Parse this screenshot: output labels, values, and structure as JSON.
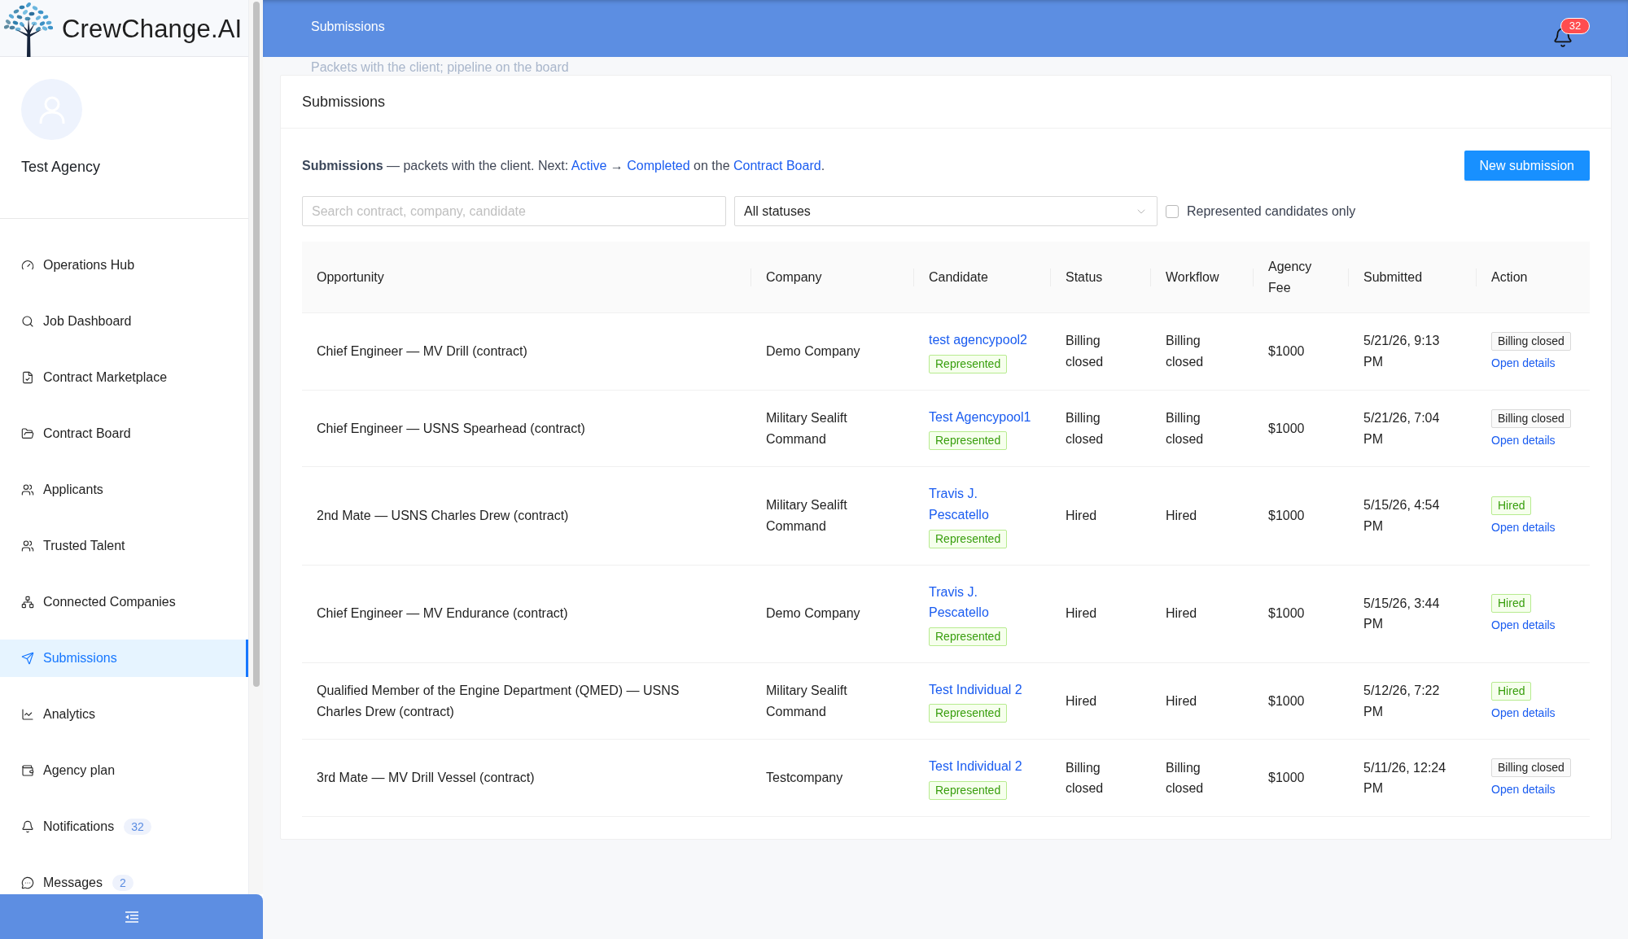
{
  "sidebar": {
    "brand": {
      "name": "CrewChange.AI"
    },
    "profile": {
      "name": "Test Agency"
    },
    "nav": [
      {
        "label": "Operations Hub",
        "selected": false
      },
      {
        "label": "Job Dashboard",
        "selected": false
      },
      {
        "label": "Contract Marketplace",
        "selected": false
      },
      {
        "label": "Contract Board",
        "selected": false
      },
      {
        "label": "Applicants",
        "selected": false
      },
      {
        "label": "Trusted Talent",
        "selected": false
      },
      {
        "label": "Connected Companies",
        "selected": false
      },
      {
        "label": "Submissions",
        "selected": true
      },
      {
        "label": "Analytics",
        "selected": false
      },
      {
        "label": "Agency plan",
        "selected": false
      },
      {
        "label": "Notifications",
        "selected": false,
        "badge": "32"
      },
      {
        "label": "Messages",
        "selected": false,
        "badge": "2"
      }
    ]
  },
  "header": {
    "title": "Submissions",
    "subtitle": "Packets with the client; pipeline on the board",
    "notification_count": "32"
  },
  "card": {
    "title": "Submissions",
    "intro": [
      {
        "kind": "text",
        "text": "**Submissions** — packets with the client. Next: "
      },
      {
        "kind": "link",
        "text": "Active"
      },
      {
        "kind": "text",
        "text": " → "
      },
      {
        "kind": "link",
        "text": "Completed"
      },
      {
        "kind": "text",
        "text": " on the "
      },
      {
        "kind": "link",
        "text": "Contract Board"
      },
      {
        "kind": "text",
        "text": "."
      }
    ],
    "new_button": "New submission"
  },
  "filters": {
    "search": {
      "placeholder": "Search contract, company, candidate"
    },
    "status": {
      "value": "All statuses"
    },
    "represented_only": {
      "label": "Represented candidates only",
      "checked": false
    }
  },
  "table": {
    "columns": [
      "Opportunity",
      "Company",
      "Candidate",
      "Status",
      "Workflow",
      "Agency Fee",
      "Submitted",
      "Action"
    ],
    "rows": [
      {
        "opportunity": "Chief Engineer — MV Drill (contract)",
        "company": "Demo Company",
        "candidate": {
          "name": "test agencypool2",
          "tag": "Represented"
        },
        "status": "Billing closed",
        "workflow": "Billing closed",
        "agency_fee": "$1000",
        "submitted": "5/21/26, 9:13 PM",
        "action": {
          "tag": "Billing closed",
          "kind": "neutral",
          "link": "Open details"
        }
      },
      {
        "opportunity": "Chief Engineer — USNS Spearhead (contract)",
        "company": "Military Sealift Command",
        "candidate": {
          "name": "Test Agencypool1",
          "tag": "Represented"
        },
        "status": "Billing closed",
        "workflow": "Billing closed",
        "agency_fee": "$1000",
        "submitted": "5/21/26, 7:04 PM",
        "action": {
          "tag": "Billing closed",
          "kind": "neutral",
          "link": "Open details"
        }
      },
      {
        "opportunity": "2nd Mate — USNS Charles Drew (contract)",
        "company": "Military Sealift Command",
        "candidate": {
          "name": "Travis J. Pescatello",
          "tag": "Represented"
        },
        "status": "Hired",
        "workflow": "Hired",
        "agency_fee": "$1000",
        "submitted": "5/15/26, 4:54 PM",
        "action": {
          "tag": "Hired",
          "kind": "success",
          "link": "Open details"
        }
      },
      {
        "opportunity": "Chief Engineer — MV Endurance (contract)",
        "company": "Demo Company",
        "candidate": {
          "name": "Travis J. Pescatello",
          "tag": "Represented"
        },
        "status": "Hired",
        "workflow": "Hired",
        "agency_fee": "$1000",
        "submitted": "5/15/26, 3:44 PM",
        "action": {
          "tag": "Hired",
          "kind": "success",
          "link": "Open details"
        }
      },
      {
        "opportunity": "Qualified Member of the Engine Department (QMED) — USNS Charles Drew (contract)",
        "company": "Military Sealift Command",
        "candidate": {
          "name": "Test Individual 2",
          "tag": "Represented"
        },
        "status": "Hired",
        "workflow": "Hired",
        "agency_fee": "$1000",
        "submitted": "5/12/26, 7:22 PM",
        "action": {
          "tag": "Hired",
          "kind": "success",
          "link": "Open details"
        }
      },
      {
        "opportunity": "3rd Mate — MV Drill Vessel (contract)",
        "company": "Testcompany",
        "candidate": {
          "name": "Test Individual 2",
          "tag": "Represented"
        },
        "status": "Billing closed",
        "workflow": "Billing closed",
        "agency_fee": "$1000",
        "submitted": "5/11/26, 12:24 PM",
        "action": {
          "tag": "Billing closed",
          "kind": "neutral",
          "link": "Open details"
        }
      }
    ]
  }
}
